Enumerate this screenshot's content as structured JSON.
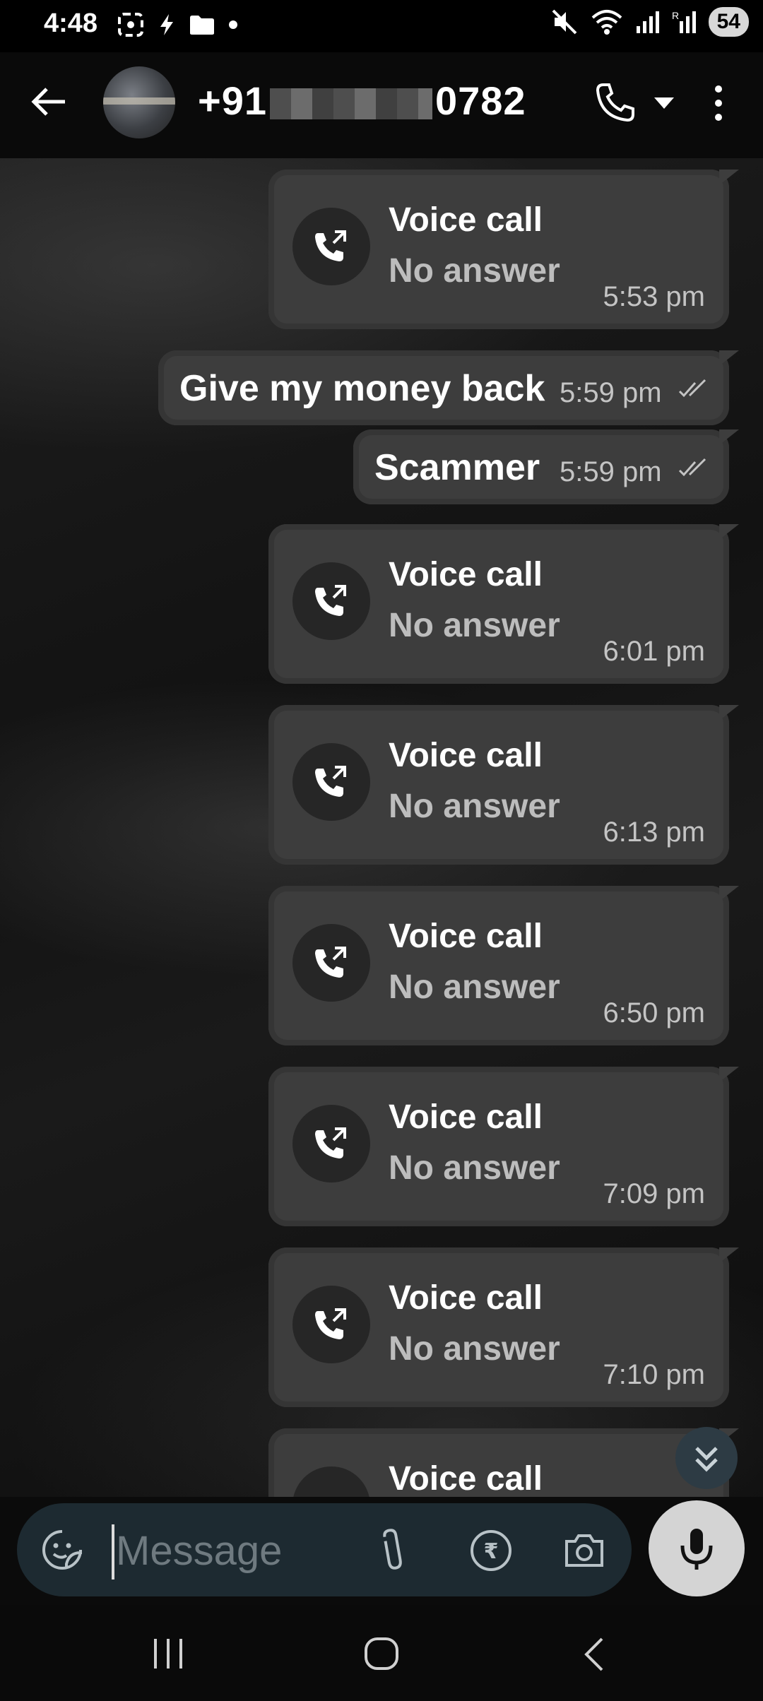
{
  "status_bar": {
    "time": "4:48",
    "battery": "54",
    "left_icons": [
      "screenshot-icon",
      "bolt-icon",
      "folder-icon",
      "dot-icon"
    ],
    "right_icons": [
      "mute-icon",
      "wifi-icon",
      "signal-icon",
      "signal-r-icon"
    ]
  },
  "header": {
    "title_prefix": "+91",
    "title_suffix": "0782"
  },
  "messages": [
    {
      "kind": "call",
      "title": "Voice call",
      "subtitle": "No answer",
      "time": "5:53 pm"
    },
    {
      "kind": "text",
      "text": "Give my money back",
      "time": "5:59 pm"
    },
    {
      "kind": "text",
      "text": "Scammer",
      "time": "5:59 pm"
    },
    {
      "kind": "call",
      "title": "Voice call",
      "subtitle": "No answer",
      "time": "6:01 pm"
    },
    {
      "kind": "call",
      "title": "Voice call",
      "subtitle": "No answer",
      "time": "6:13 pm"
    },
    {
      "kind": "call",
      "title": "Voice call",
      "subtitle": "No answer",
      "time": "6:50 pm"
    },
    {
      "kind": "call",
      "title": "Voice call",
      "subtitle": "No answer",
      "time": "7:09 pm"
    },
    {
      "kind": "call",
      "title": "Voice call",
      "subtitle": "No answer",
      "time": "7:10 pm"
    },
    {
      "kind": "call",
      "title": "Voice call",
      "subtitle": "",
      "time": ""
    }
  ],
  "input": {
    "placeholder": "Message"
  },
  "colors": {
    "bubble": "#3d3d3d",
    "input_bar": "#1d2a31",
    "mic_button": "#d4d4d4"
  }
}
